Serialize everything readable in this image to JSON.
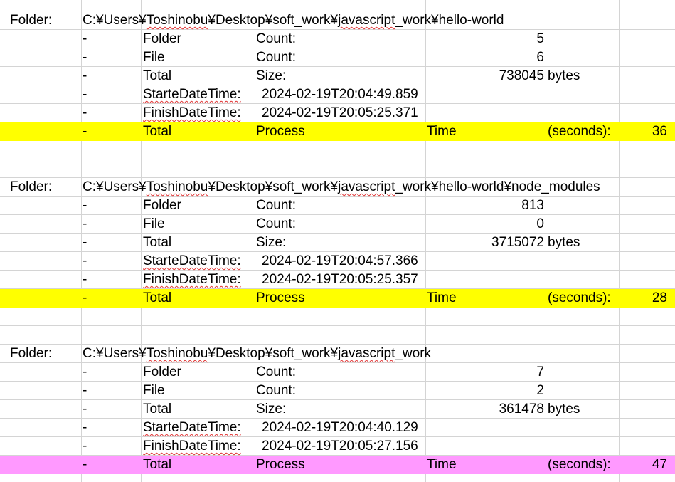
{
  "sheet": {
    "blocks": [
      {
        "folder_label": "Folder:",
        "path": "C:¥Users¥Toshinobu¥Desktop¥soft_work¥javascript_work¥hello-world",
        "rows": [
          {
            "dash": "-",
            "name": "Folder",
            "kind": "Count:",
            "value": "5",
            "unit": ""
          },
          {
            "dash": "-",
            "name": "File",
            "kind": "Count:",
            "value": "6",
            "unit": ""
          },
          {
            "dash": "-",
            "name": "Total",
            "kind": "Size:",
            "value": "738045",
            "unit": "bytes"
          }
        ],
        "start_label": "StarteDateTime:",
        "start_value": "2024-02-19T20:04:49.859",
        "finish_label": "FinishDateTime:",
        "finish_value": "2024-02-19T20:05:25.371",
        "summary": {
          "dash": "-",
          "a": "Total",
          "b": "Process",
          "c": "Time",
          "d": "(seconds):",
          "value": "36"
        },
        "summary_color": "#ffff00"
      },
      {
        "folder_label": "Folder:",
        "path": "C:¥Users¥Toshinobu¥Desktop¥soft_work¥javascript_work¥hello-world¥node_modules",
        "rows": [
          {
            "dash": "-",
            "name": "Folder",
            "kind": "Count:",
            "value": "813",
            "unit": ""
          },
          {
            "dash": "-",
            "name": "File",
            "kind": "Count:",
            "value": "0",
            "unit": ""
          },
          {
            "dash": "-",
            "name": "Total",
            "kind": "Size:",
            "value": "3715072",
            "unit": "bytes"
          }
        ],
        "start_label": "StarteDateTime:",
        "start_value": "2024-02-19T20:04:57.366",
        "finish_label": "FinishDateTime:",
        "finish_value": "2024-02-19T20:05:25.357",
        "summary": {
          "dash": "-",
          "a": "Total",
          "b": "Process",
          "c": "Time",
          "d": "(seconds):",
          "value": "28"
        },
        "summary_color": "#ffff00"
      },
      {
        "folder_label": "Folder:",
        "path": "C:¥Users¥Toshinobu¥Desktop¥soft_work¥javascript_work",
        "rows": [
          {
            "dash": "-",
            "name": "Folder",
            "kind": "Count:",
            "value": "7",
            "unit": ""
          },
          {
            "dash": "-",
            "name": "File",
            "kind": "Count:",
            "value": "2",
            "unit": ""
          },
          {
            "dash": "-",
            "name": "Total",
            "kind": "Size:",
            "value": "361478",
            "unit": "bytes"
          }
        ],
        "start_label": "StarteDateTime:",
        "start_value": "2024-02-19T20:04:40.129",
        "finish_label": "FinishDateTime:",
        "finish_value": "2024-02-19T20:05:27.156",
        "summary": {
          "dash": "-",
          "a": "Total",
          "b": "Process",
          "c": "Time",
          "d": "(seconds):",
          "value": "47"
        },
        "summary_color": "#ff99ff"
      }
    ]
  }
}
